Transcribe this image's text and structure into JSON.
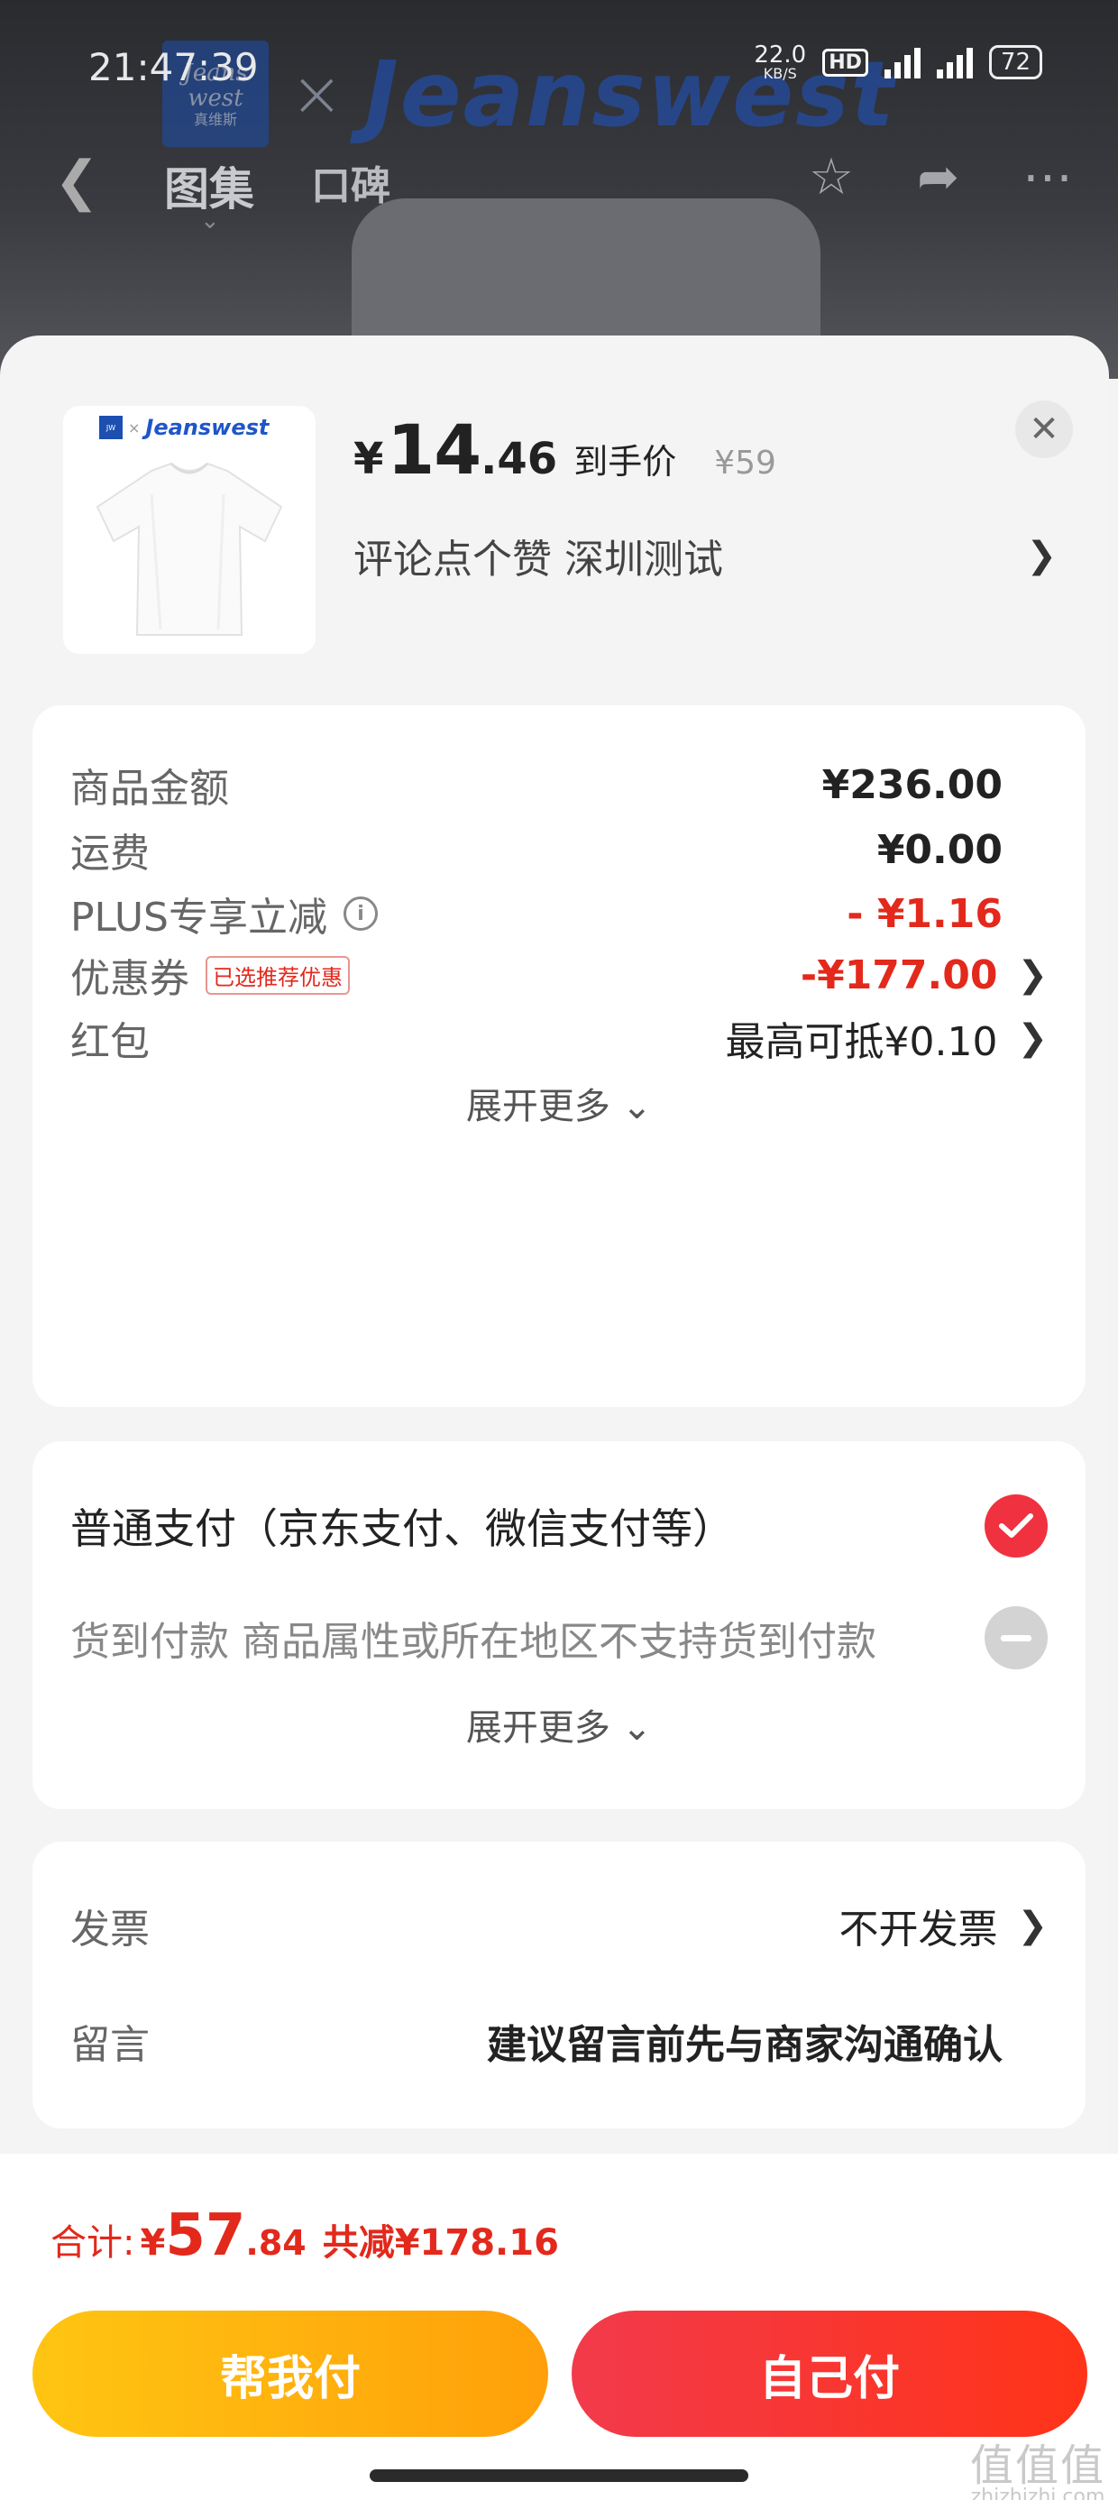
{
  "status_bar": {
    "time": "21:47:39",
    "net_speed": "22.0",
    "net_unit": "KB/S",
    "hd": "HD",
    "battery": "72"
  },
  "background_page": {
    "brand_logo_lines": [
      "Jeans",
      "west",
      "真维斯"
    ],
    "brand_x": "×",
    "brand_wordmark": "Jeanswest",
    "tabs": [
      "图集",
      "口碑"
    ]
  },
  "product": {
    "thumb_brand": "Jeanswest",
    "price_symbol": "¥",
    "price_int": "14",
    "price_dec": ".46",
    "price_label": "到手价",
    "original_price": "¥59",
    "spec_text": "评论点个赞  深圳测试"
  },
  "summary": {
    "rows": [
      {
        "label": "商品金额",
        "value": "¥236.00"
      },
      {
        "label": "运费",
        "value": "¥0.00"
      },
      {
        "label": "PLUS专享立减",
        "value": "- ¥1.16"
      },
      {
        "label": "优惠券",
        "tag": "已选推荐优惠",
        "value": "-¥177.00"
      },
      {
        "label": "红包",
        "value": "最高可抵¥0.10"
      }
    ],
    "more": "展开更多"
  },
  "payment": {
    "options": [
      {
        "label": "普通支付（京东支付、微信支付等）",
        "selected": true
      },
      {
        "label": "货到付款  商品属性或所在地区不支持货到付款",
        "selected": false
      }
    ],
    "more": "展开更多"
  },
  "extra": {
    "invoice_label": "发票",
    "invoice_value": "不开发票",
    "message_label": "留言",
    "message_placeholder": "建议留言前先与商家沟通确认"
  },
  "footer": {
    "total_label": "合计:",
    "total_symbol": "¥",
    "total_int": "57",
    "total_dec": ".84",
    "saved": "共减¥178.16",
    "help_pay": "帮我付",
    "self_pay": "自己付"
  },
  "watermark": {
    "glyphs": "值值值",
    "site": "zhizhizhi.com"
  },
  "colors": {
    "accent_red": "#e2291c",
    "button_yellow": "#ffb20e",
    "button_red": "#f5343a"
  }
}
